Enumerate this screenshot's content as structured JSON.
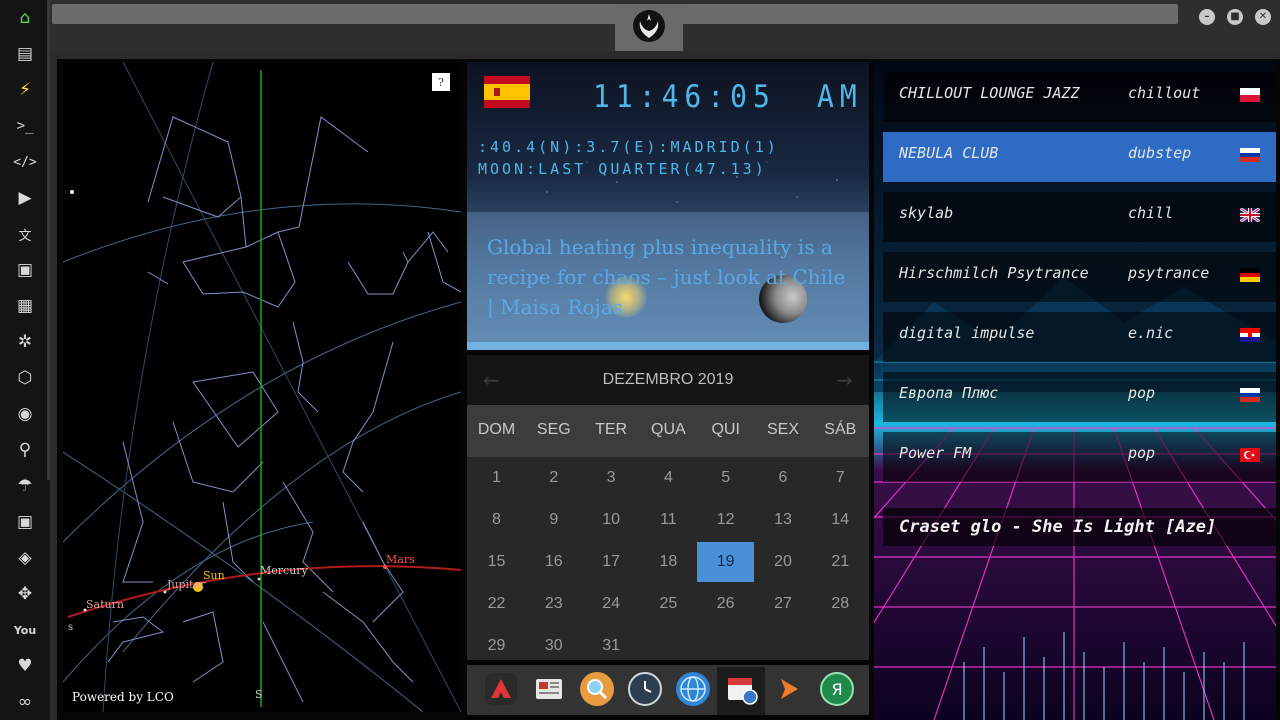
{
  "launcher": {
    "icons": [
      "home-icon",
      "document-icon",
      "bolt-icon",
      "terminal-icon",
      "code-icon",
      "play-icon",
      "translate-icon",
      "image-icon",
      "newspaper-icon",
      "asterisk-icon",
      "hexagon-icon",
      "globe-icon",
      "search-icon",
      "umbrella-icon",
      "contacts-icon",
      "tag-icon",
      "expand-icon",
      "youtube-icon",
      "heart-icon",
      "infinity-icon"
    ]
  },
  "window": {
    "minimize": "–",
    "maximize": "■",
    "close": "✕"
  },
  "skymap": {
    "help": "?",
    "powered_by": "Powered by LCO",
    "planets": {
      "saturn": "Saturn",
      "jupiter": "Jupiter",
      "sun": "Sun",
      "mercury": "Mercury",
      "mars": "Mars"
    },
    "south_left": "s",
    "south_bottom": "S"
  },
  "clock": {
    "time": "11:46:05",
    "ampm": "AM",
    "location": ":40.4(N):3.7(E):MADRID(1)",
    "moon": "MOON:LAST QUARTER(47.13)",
    "headline": "Global heating plus inequality is a recipe for chaos – just look at Chile | Maisa Rojas",
    "flag": "spain-flag"
  },
  "calendar": {
    "month": "DEZEMBRO 2019",
    "prev": "←",
    "next": "→",
    "weekdays": [
      "DOM",
      "SEG",
      "TER",
      "QUA",
      "QUI",
      "SEX",
      "SÁB"
    ],
    "weeks": [
      [
        "1",
        "2",
        "3",
        "4",
        "5",
        "6",
        "7"
      ],
      [
        "8",
        "9",
        "10",
        "11",
        "12",
        "13",
        "14"
      ],
      [
        "15",
        "16",
        "17",
        "18",
        "19",
        "20",
        "21"
      ],
      [
        "22",
        "23",
        "24",
        "25",
        "26",
        "27",
        "28"
      ],
      [
        "29",
        "30",
        "31",
        "",
        "",
        "",
        ""
      ]
    ],
    "selected": "19"
  },
  "dock": {
    "apps": [
      "arrow-up-app-icon",
      "newspaper-app-icon",
      "search-app-icon",
      "clock-app-icon",
      "globe-app-icon",
      "calendar-app-icon",
      "play-app-icon",
      "yandex-app-icon"
    ],
    "yandex_letter": "Я"
  },
  "radio": {
    "stations": [
      {
        "name": "CHILLOUT LOUNGE JAZZ",
        "genre": "chillout",
        "flag": "poland"
      },
      {
        "name": "NEBULA CLUB",
        "genre": "dubstep",
        "flag": "russia"
      },
      {
        "name": "skylab",
        "genre": "chill",
        "flag": "uk"
      },
      {
        "name": "Hirschmilch Psytrance",
        "genre": "psytrance",
        "flag": "germany"
      },
      {
        "name": "digital impulse",
        "genre": "e.nic",
        "flag": "croatia"
      },
      {
        "name": "Европа Плюс",
        "genre": "pop",
        "flag": "russia"
      },
      {
        "name": "Power FM",
        "genre": "pop",
        "flag": "turkey"
      }
    ],
    "selected_index": 1,
    "now_playing": "Craset glo - She Is Light [Aze]"
  }
}
